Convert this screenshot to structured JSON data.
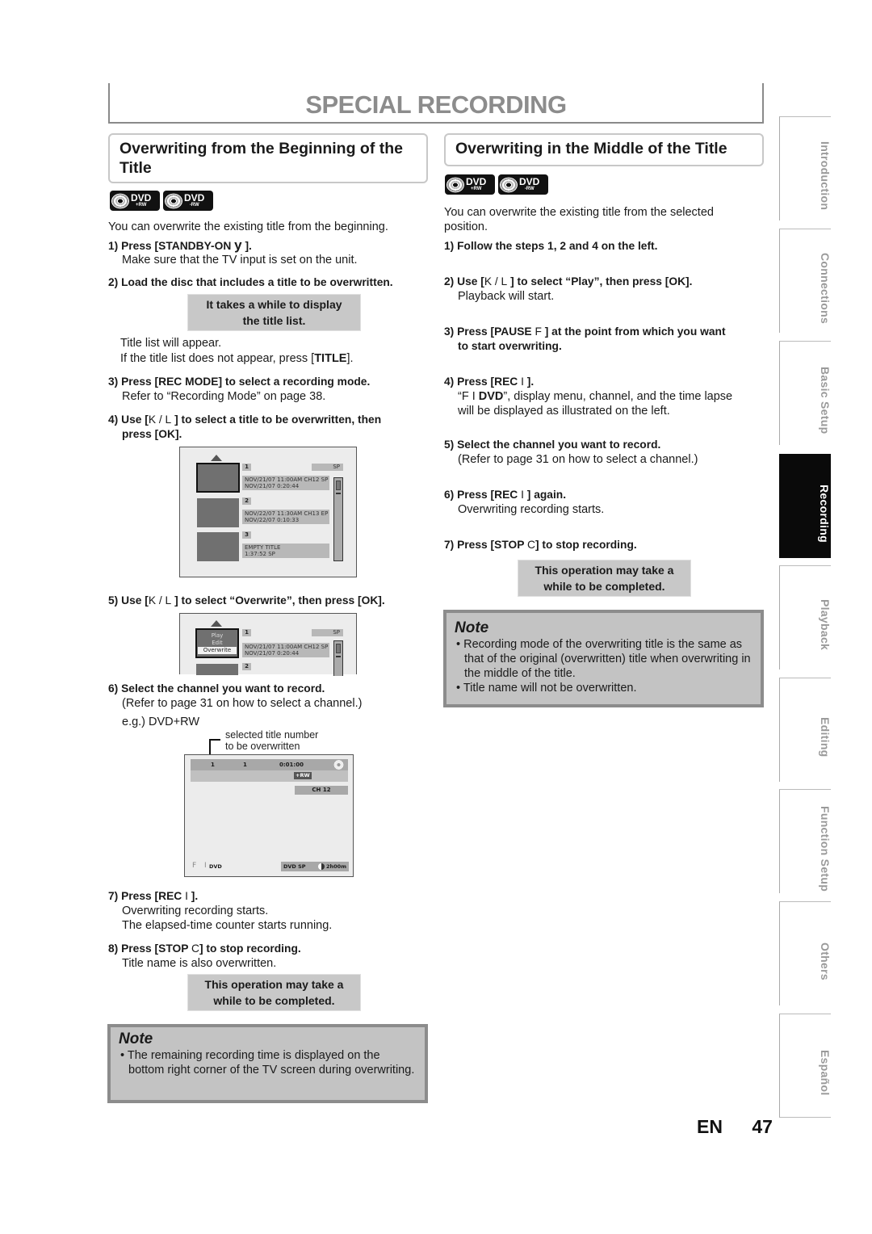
{
  "page_title": "SPECIAL RECORDING",
  "left": {
    "heading": "Overwriting from the Beginning of the Title",
    "disc_badges": [
      {
        "name": "DVD",
        "sub": "+RW"
      },
      {
        "name": "DVD",
        "sub": "-RW"
      }
    ],
    "intro": "You can overwrite the existing title from the beginning.",
    "steps": [
      {
        "label": "1) Press [STANDBY-ON ",
        "glyph": "y",
        "label_end": " ].",
        "desc": "Make sure that the TV input is set on the unit."
      },
      {
        "label": "2) Load the disc that includes a title to be overwritten."
      },
      {
        "callout": [
          "It takes a while to display",
          "the title list."
        ]
      },
      {
        "desc_lines": [
          "Title list will appear."
        ],
        "desc_pre": "If the title list does not appear, press [",
        "desc_bold": "TITLE",
        "desc_post": "]."
      },
      {
        "label": "3) Press [REC MODE] to select a recording mode.",
        "desc": "Refer to “Recording Mode” on page 38."
      },
      {
        "label_pre": "4) Use [",
        "glyph": "K / L",
        "label_post": " ] to select a title to be overwritten, then",
        "label_line2": "press [OK]."
      },
      {
        "label_pre": "5) Use [",
        "glyph": "K / L",
        "label_post": " ] to select “Overwrite”, then press [OK]."
      },
      {
        "label": "6) Select the channel you want to record.",
        "desc": "(Refer to page 31 on how to select a channel.)",
        "example": "e.g.) DVD+RW"
      },
      {
        "label_pre": "7) Press [REC ",
        "glyph": "I",
        "label_post": " ].",
        "desc_lines": [
          "Overwriting recording starts.",
          "The elapsed-time counter starts running."
        ]
      },
      {
        "label_pre": "8) Press [STOP ",
        "glyph": "C",
        "label_post": "] to stop recording.",
        "desc": "Title name is also overwritten."
      }
    ],
    "callout2": [
      "This operation may take a",
      "while to be completed."
    ],
    "note": {
      "title": "Note",
      "bullets": [
        "The remaining recording time is displayed on the bottom right corner of the TV screen during overwriting."
      ]
    }
  },
  "title_list_screen": {
    "mode": "SP",
    "items": [
      {
        "num": "1",
        "line1": "NOV/21/07  11:00AM CH12  SP",
        "line2": "NOV/21/07    0:20:44"
      },
      {
        "num": "2",
        "line1": "NOV/22/07  11:30AM CH13  EP",
        "line2": "NOV/22/07    0:10:33"
      },
      {
        "num": "3",
        "line1": "EMPTY TITLE",
        "line2": "1:37:52  SP"
      }
    ]
  },
  "overwrite_menu_screen": {
    "mode": "SP",
    "menu": [
      "Play",
      "Edit",
      "Overwrite"
    ],
    "items": [
      {
        "num": "1",
        "line1": "NOV/21/07  11:00AM CH12  SP",
        "line2": "NOV/21/07    0:20:44"
      },
      {
        "num": "2"
      }
    ]
  },
  "recording_screen": {
    "annotation": [
      "selected title number",
      "to be overwritten"
    ],
    "title_no": "1",
    "chapter_no": "1",
    "elapsed": "0:01:00",
    "disc_type": "+RW",
    "channel": "CH  12",
    "status_glyph": "F",
    "status_rec": "I",
    "status_label": "DVD",
    "rec_mode": "DVD SP",
    "remaining": "2h00m"
  },
  "right": {
    "heading": "Overwriting in the Middle of the Title",
    "disc_badges": [
      {
        "name": "DVD",
        "sub": "+RW"
      },
      {
        "name": "DVD",
        "sub": "-RW"
      }
    ],
    "intro": "You can overwrite the existing title from the selected position.",
    "steps": [
      {
        "label": "1) Follow the steps 1, 2 and 4 on the left."
      },
      {
        "label_pre": "2) Use [",
        "glyph": "K / L",
        "label_post": " ] to select “Play”, then press [OK].",
        "desc": "Playback will start."
      },
      {
        "label_pre": "3) Press [PAUSE ",
        "glyph": "F",
        "label_post": " ] at the point from which you want",
        "label_line2": "to start overwriting."
      },
      {
        "label_pre": "4) Press [REC ",
        "glyph": "I",
        "label_post": " ].",
        "desc_pre": "“F I  ",
        "desc_bold": "DVD",
        "desc_post": "”, display menu, channel, and the time lapse",
        "desc_line2": "will be displayed as illustrated on the left."
      },
      {
        "label": "5) Select the channel you want to record.",
        "desc": "(Refer to page 31 on how to select a channel.)"
      },
      {
        "label_pre": "6) Press [REC ",
        "glyph": "I",
        "label_post": " ] again.",
        "desc": "Overwriting recording starts."
      },
      {
        "label_pre": "7) Press [STOP ",
        "glyph": "C",
        "label_post": "] to stop recording."
      }
    ],
    "callout": [
      "This operation may take a",
      "while to be completed."
    ],
    "note": {
      "title": "Note",
      "bullets": [
        "Recording mode of the overwriting title is the same as that of the original (overwritten) title when overwriting in the middle of the title.",
        "Title name will not be overwritten."
      ]
    }
  },
  "side_tabs": [
    {
      "label": "Introduction",
      "active": false
    },
    {
      "label": "Connections",
      "active": false
    },
    {
      "label": "Basic Setup",
      "active": false
    },
    {
      "label": "Recording",
      "active": true
    },
    {
      "label": "Playback",
      "active": false
    },
    {
      "label": "Editing",
      "active": false
    },
    {
      "label": "Function Setup",
      "active": false
    },
    {
      "label": "Others",
      "active": false
    },
    {
      "label": "Español",
      "active": false
    }
  ],
  "footer": {
    "lang": "EN",
    "page": "47"
  }
}
